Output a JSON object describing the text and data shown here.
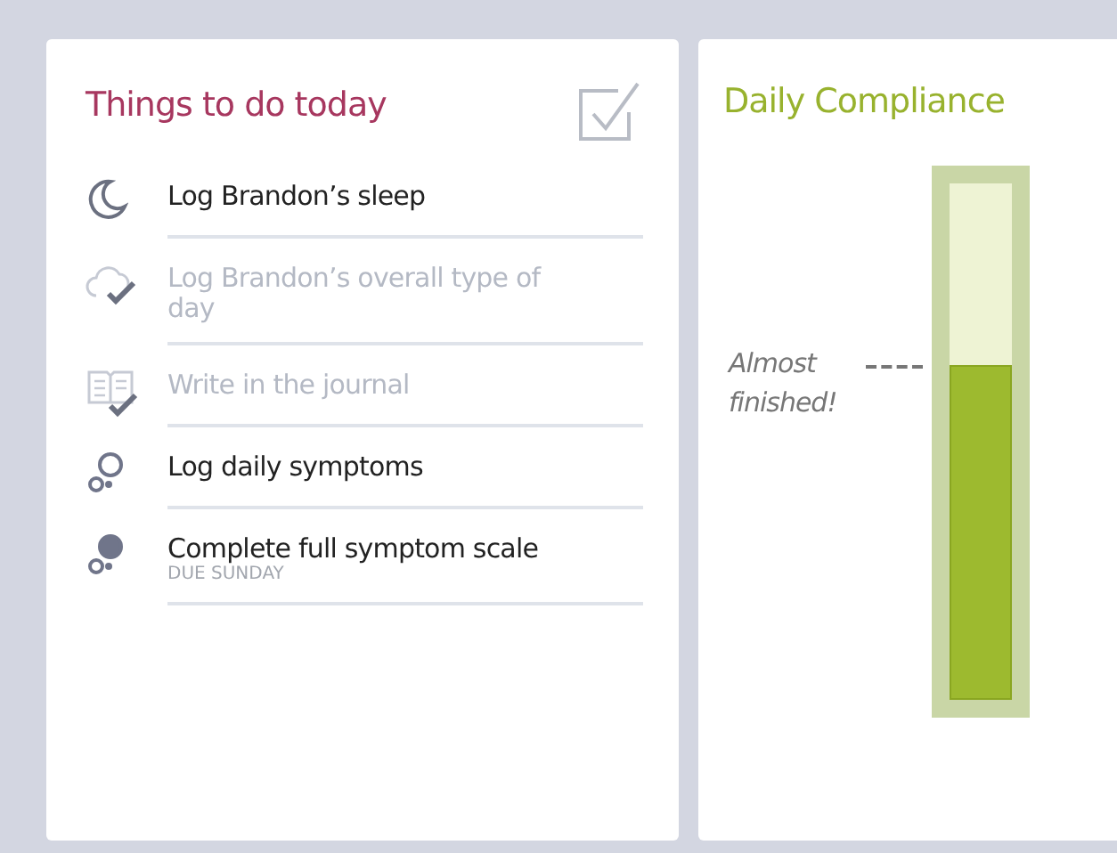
{
  "todo": {
    "title": "Things to do today",
    "tasks": [
      {
        "kind": "sleep",
        "label": "Log Brandon’s sleep",
        "done": false
      },
      {
        "kind": "day",
        "label": "Log Brandon’s overall type of day",
        "done": true
      },
      {
        "kind": "journal",
        "label": "Write in the journal",
        "done": true
      },
      {
        "kind": "symptoms",
        "label": "Log daily symptoms",
        "done": false
      },
      {
        "kind": "scale",
        "label": "Complete full symptom scale",
        "due": "DUE SUNDAY",
        "done": false
      }
    ]
  },
  "compliance": {
    "title": "Daily Compliance",
    "note": "Almost finished!",
    "level": 0.65
  }
}
